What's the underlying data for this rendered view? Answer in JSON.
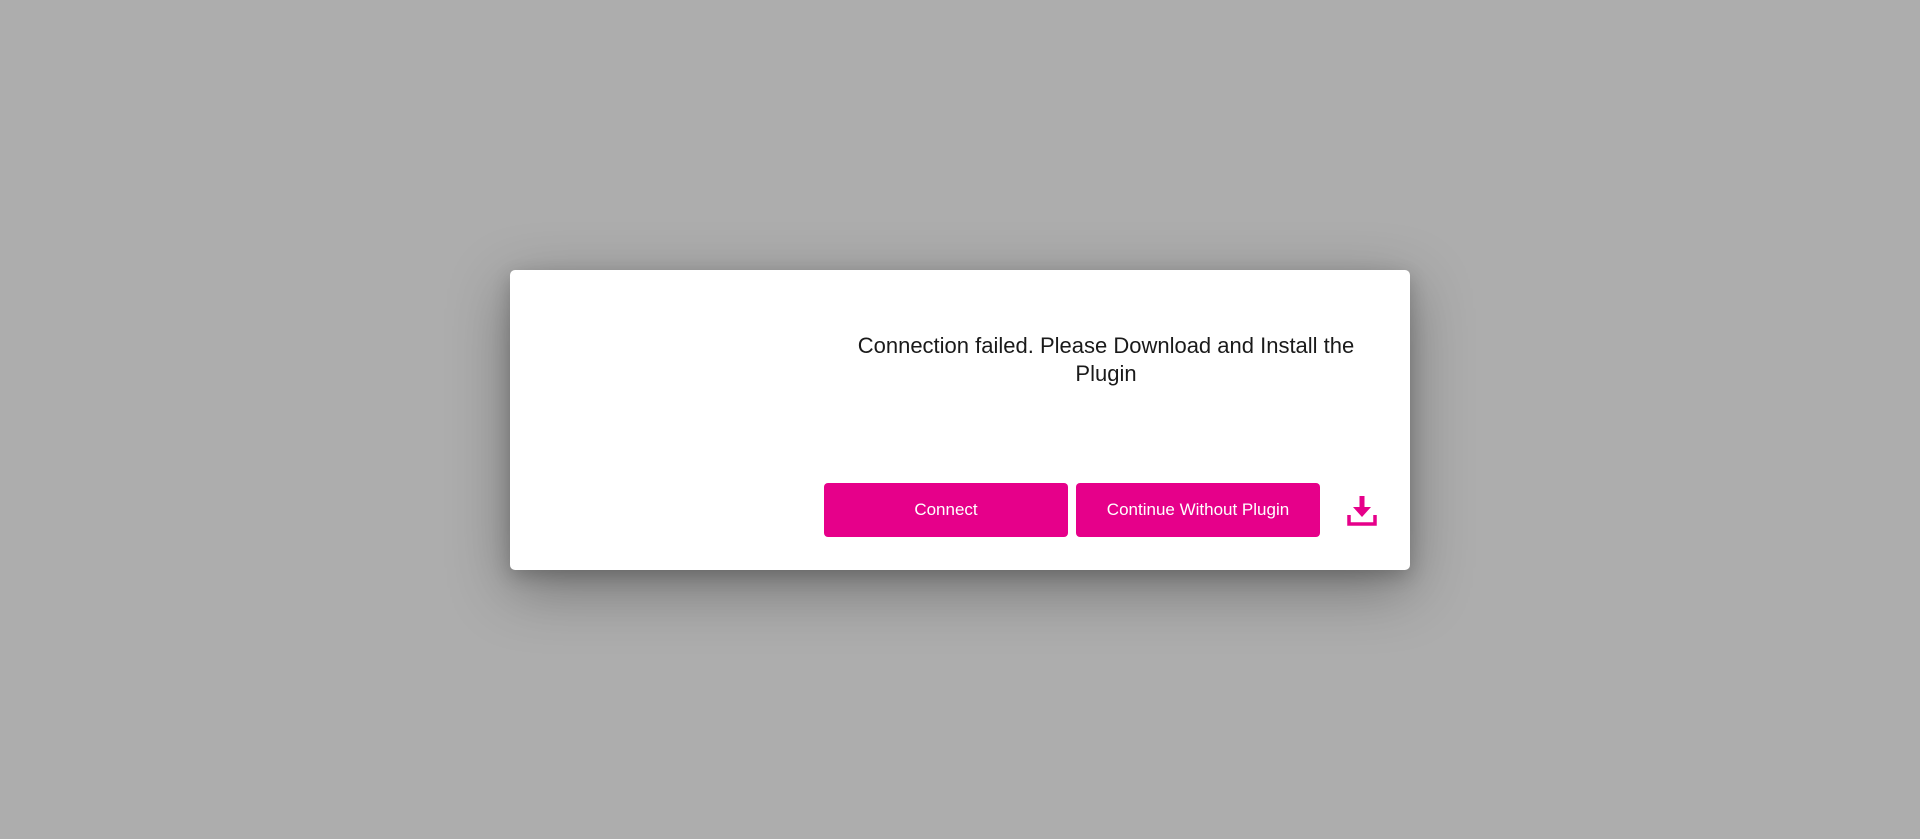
{
  "dialog": {
    "message": "Connection failed. Please Download and Install the Plugin",
    "connect_label": "Connect",
    "continue_label": "Continue Without Plugin",
    "download_icon": "download-icon"
  },
  "colors": {
    "accent": "#e6008a",
    "backdrop": "#adadad",
    "dialog_bg": "#ffffff"
  }
}
